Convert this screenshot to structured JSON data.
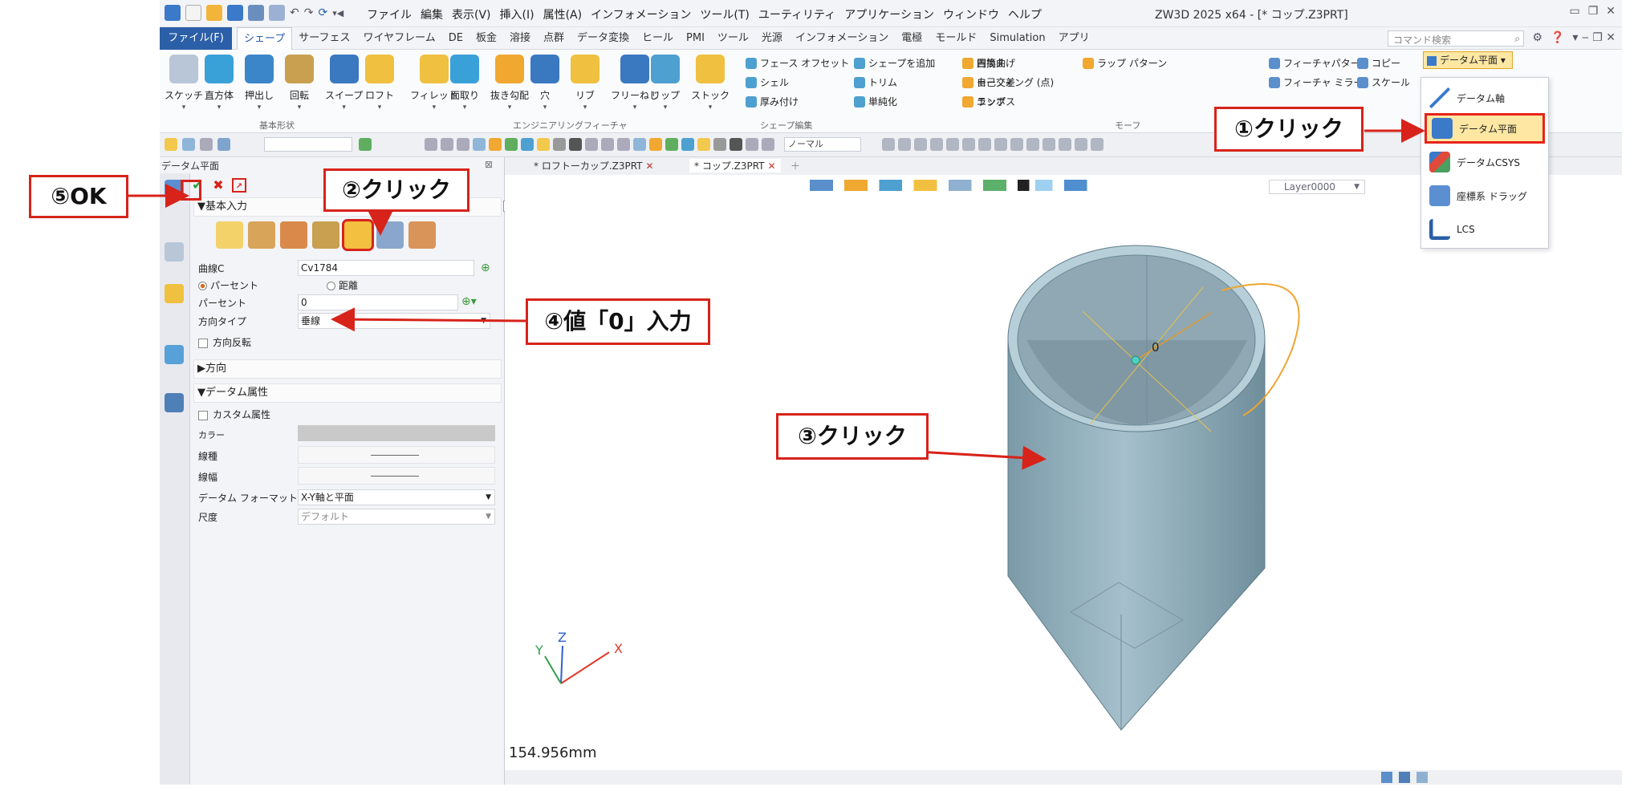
{
  "titlebar": {
    "menu": [
      "ファイル",
      "編集",
      "表示(V)",
      "挿入(I)",
      "属性(A)",
      "インフォメーション",
      "ツール(T)",
      "ユーティリティ",
      "アプリケーション",
      "ウィンドウ",
      "ヘルプ"
    ],
    "app_title": "ZW3D 2025 x64 - [* コップ.Z3PRT]"
  },
  "ribbon_tabs": {
    "file": "ファイル(F)",
    "tabs": [
      "シェープ",
      "サーフェス",
      "ワイヤフレーム",
      "DE",
      "板金",
      "溶接",
      "点群",
      "データ変換",
      "ヒール",
      "PMI",
      "ツール",
      "光源",
      "インフォメーション",
      "電極",
      "モールド",
      "Simulation",
      "アプリ"
    ],
    "active": "シェープ",
    "search_placeholder": "コマンド検索"
  },
  "ribbon": {
    "basic_shapes": [
      "スケッチ",
      "直方体",
      "押出し",
      "回転",
      "スイープ",
      "ロフト"
    ],
    "basic_group_label": "基本形状",
    "eng_features": [
      "フィレット",
      "面取り",
      "抜き勾配",
      "穴",
      "リブ",
      "フリーねじ",
      "リップ",
      "ストック"
    ],
    "eng_group_label": "エンジニアリングフィーチャ",
    "edit_small": [
      "フェース オフセット",
      "シェル",
      "厚み付け",
      "シェープを追加",
      "トリム",
      "単純化",
      "置換え",
      "自己交差",
      "エンボス"
    ],
    "edit_group_label": "シェープ編集",
    "morph_small": [
      "円筒曲げ",
      "モーフィング (点)",
      "ラップ",
      "ラップ パターン"
    ],
    "morph_group_label": "モーフ",
    "pattern_small": [
      "フィーチャパターン",
      "フィーチャ ミラー",
      "コピー",
      "スケール"
    ],
    "datum_button": "データム平面"
  },
  "toolbar": {
    "filter_combo": "ノーマル"
  },
  "panel": {
    "title": "データム平面",
    "section_basic": "▼基本入力",
    "curve_label": "曲線C",
    "curve_value": "Cv1784",
    "radio_percent": "パーセント",
    "radio_distance": "距離",
    "percent_label": "パーセント",
    "percent_value": "0",
    "dirtype_label": "方向タイプ",
    "dirtype_value": "垂線",
    "flip_label": "方向反転",
    "section_direction": "▶方向",
    "section_attr": "▼データム属性",
    "custom_attr": "カスタム属性",
    "color_label": "カラー",
    "linetype_label": "線種",
    "linewidth_label": "線幅",
    "format_label": "データム フォーマット",
    "format_value": "X-Y軸と平面",
    "scale_label": "尺度",
    "scale_value": "デフォルト"
  },
  "doc_tabs": [
    "* ロフトーカップ.Z3PRT",
    "* コップ.Z3PRT"
  ],
  "viewport": {
    "layer": "Layer0000",
    "dimension": "154.956mm",
    "point_label": "0",
    "axes": {
      "x": "X",
      "y": "Y",
      "z": "Z"
    }
  },
  "dropdown": {
    "items": [
      "データム軸",
      "データム平面",
      "データムCSYS",
      "座標系 ドラッグ",
      "LCS"
    ]
  },
  "callouts": {
    "c1": "①クリック",
    "c2": "②クリック",
    "c3": "③クリック",
    "c4": "④値「0」入力",
    "c5": "⑤OK"
  },
  "colors": {
    "callout_red": "#d7231a",
    "file_tab": "#2b5fa7",
    "highlight": "#fde7a3",
    "cup": "#90aebb"
  }
}
